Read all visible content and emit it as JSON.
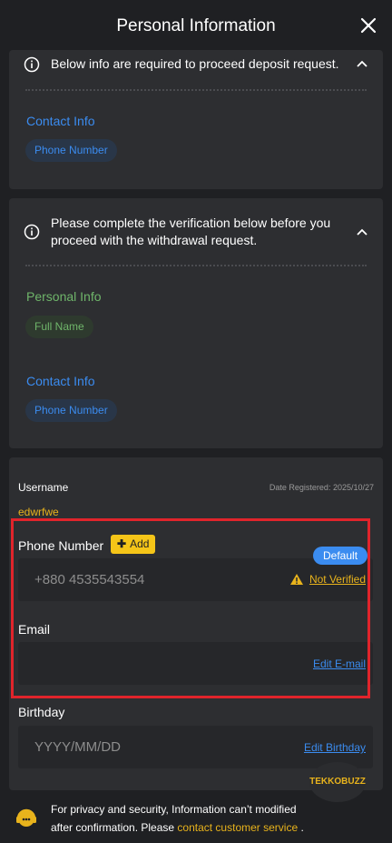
{
  "header": {
    "title": "Personal Information",
    "close_icon": "close-icon"
  },
  "deposit_card": {
    "notice": "Below info are required to proceed deposit request.",
    "contact_title": "Contact Info",
    "contact_pill": "Phone Number"
  },
  "withdraw_card": {
    "notice": "Please complete the verification below before you proceed with the withdrawal request.",
    "personal_title": "Personal Info",
    "personal_pill": "Full Name",
    "contact_title": "Contact Info",
    "contact_pill": "Phone Number"
  },
  "profile": {
    "username_label": "Username",
    "username_value": "edwrfwe",
    "date_registered": "Date Registered: 2025/10/27",
    "phone_label": "Phone Number",
    "add_label": "Add",
    "default_badge": "Default",
    "phone_value": "+880 4535543554",
    "not_verified": "Not Verified",
    "email_label": "Email",
    "edit_email": "Edit E-mail",
    "birthday_label": "Birthday",
    "birthday_placeholder": "YYYY/MM/DD",
    "edit_birthday": "Edit Birthday"
  },
  "watermark": "TEKKOBUZZ",
  "footer": {
    "line1": "For privacy and security, Information can’t modified",
    "line2_prefix": "after confirmation. Please ",
    "link": "contact customer service",
    "line2_suffix": " ."
  },
  "colors": {
    "background": "#1f2023",
    "card": "#2d2e31",
    "accent_blue": "#3b8cf0",
    "accent_green": "#6fb56a",
    "accent_yellow": "#e8b31c",
    "highlight_red": "#e0242b"
  }
}
